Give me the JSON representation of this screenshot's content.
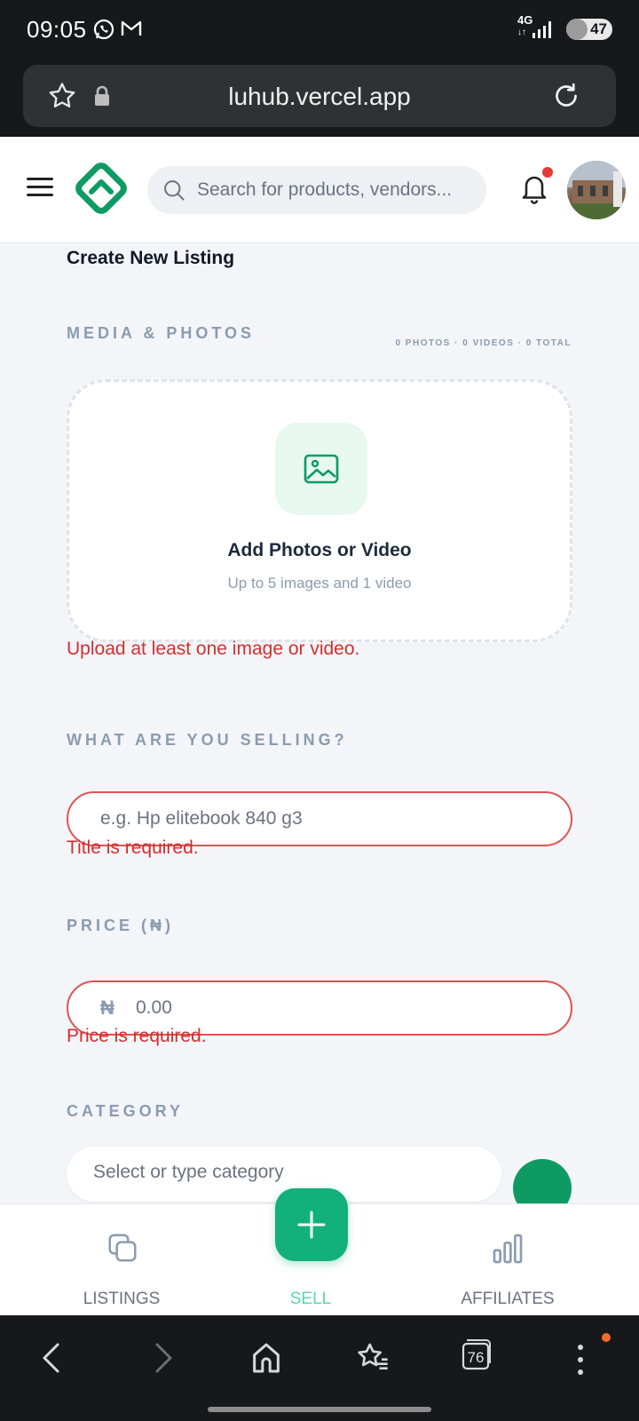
{
  "status_bar": {
    "time": "09:05",
    "network": "4G",
    "battery": "47",
    "battery_level": 0.47,
    "icons": [
      "whatsapp-icon",
      "gmail-icon",
      "signal-icon",
      "battery-icon"
    ]
  },
  "browser": {
    "url": "luhub.vercel.app",
    "tab_count": "76",
    "icons": [
      "bookmark-star-icon",
      "lock-icon",
      "reload-icon",
      "back-icon",
      "forward-icon",
      "home-icon",
      "favorites-icon",
      "tabs-icon",
      "more-icon"
    ]
  },
  "header": {
    "search_placeholder": "Search for products, vendors...",
    "icons": [
      "menu-icon",
      "logo-icon",
      "search-icon",
      "bell-icon",
      "avatar"
    ]
  },
  "form": {
    "page_title": "Create New Listing",
    "media": {
      "label": "MEDIA & PHOTOS",
      "counts": "0 PHOTOS · 0 VIDEOS · 0 TOTAL",
      "dropzone_title": "Add Photos or Video",
      "dropzone_subtitle": "Up to 5 images and 1 video",
      "error": "Upload at least one image or video."
    },
    "title": {
      "label": "WHAT ARE YOU SELLING?",
      "placeholder": "e.g. Hp elitebook 840 g3",
      "error": "Title is required."
    },
    "price": {
      "label": "PRICE (₦)",
      "currency_symbol": "₦",
      "placeholder": "0.00",
      "error": "Price is required."
    },
    "category": {
      "label": "CATEGORY",
      "placeholder": "Select or type category"
    }
  },
  "bottom_nav": {
    "items": [
      {
        "label": "LISTINGS",
        "icon": "listings-icon"
      },
      {
        "label": "SELL",
        "icon": "plus-icon"
      },
      {
        "label": "AFFILIATES",
        "icon": "bar-chart-icon"
      }
    ]
  },
  "colors": {
    "brand_green": "#12b07a",
    "error_red": "#d32f2f",
    "label_gray": "#8b9bb0"
  }
}
